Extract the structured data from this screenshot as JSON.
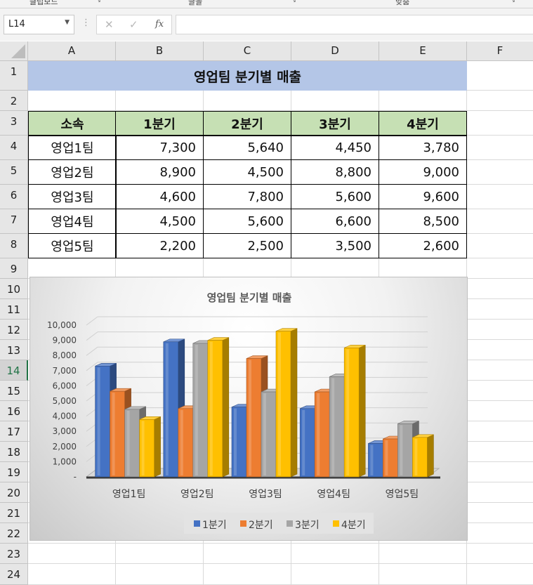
{
  "ribbon": {
    "groups": [
      "클립보드",
      "글꼴",
      "맞춤"
    ]
  },
  "formula_bar": {
    "name_box": "L14",
    "cancel_icon": "✕",
    "enter_icon": "✓",
    "fx_label": "fx",
    "formula": ""
  },
  "columns": [
    "A",
    "B",
    "C",
    "D",
    "E",
    "F"
  ],
  "rows": [
    "1",
    "2",
    "3",
    "4",
    "5",
    "6",
    "7",
    "8",
    "9",
    "10",
    "11",
    "12",
    "13",
    "14",
    "15",
    "16",
    "17",
    "18",
    "19",
    "20",
    "21",
    "22",
    "23",
    "24"
  ],
  "active_row": "14",
  "sheet": {
    "title": "영업팀 분기별 매출",
    "headers": [
      "소속",
      "1분기",
      "2분기",
      "3분기",
      "4분기"
    ],
    "table": [
      [
        "영업1팀",
        "7,300",
        "5,640",
        "4,450",
        "3,780"
      ],
      [
        "영업2팀",
        "8,900",
        "4,500",
        "8,800",
        "9,000"
      ],
      [
        "영업3팀",
        "4,600",
        "7,800",
        "5,600",
        "9,600"
      ],
      [
        "영업4팀",
        "4,500",
        "5,600",
        "6,600",
        "8,500"
      ],
      [
        "영업5팀",
        "2,200",
        "2,500",
        "3,500",
        "2,600"
      ]
    ]
  },
  "chart_data": {
    "type": "bar",
    "title": "영업팀 분기별 매출",
    "categories": [
      "영업1팀",
      "영업2팀",
      "영업3팀",
      "영업4팀",
      "영업5팀"
    ],
    "series": [
      {
        "name": "1분기",
        "values": [
          7300,
          8900,
          4600,
          4500,
          2200
        ],
        "color": "#4472c4"
      },
      {
        "name": "2분기",
        "values": [
          5640,
          4500,
          7800,
          5600,
          2500
        ],
        "color": "#ed7d31"
      },
      {
        "name": "3분기",
        "values": [
          4450,
          8800,
          5600,
          6600,
          3500
        ],
        "color": "#a5a5a5"
      },
      {
        "name": "4분기",
        "values": [
          3780,
          9000,
          9600,
          8500,
          2600
        ],
        "color": "#ffc000"
      }
    ],
    "ylim": [
      0,
      10000
    ],
    "y_ticks": [
      "-",
      "1,000",
      "2,000",
      "3,000",
      "4,000",
      "5,000",
      "6,000",
      "7,000",
      "8,000",
      "9,000",
      "10,000"
    ],
    "legend_position": "bottom",
    "grid": true,
    "style": "3d-clustered-column"
  }
}
